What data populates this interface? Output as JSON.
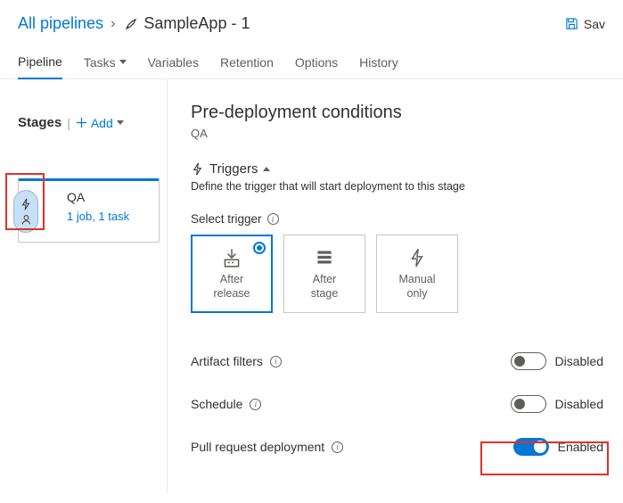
{
  "breadcrumb": {
    "root": "All pipelines",
    "title": "SampleApp - 1"
  },
  "save_label": "Sav",
  "tabs": [
    "Pipeline",
    "Tasks",
    "Variables",
    "Retention",
    "Options",
    "History"
  ],
  "stages": {
    "header": "Stages",
    "add": "Add",
    "card": {
      "name": "QA",
      "sub": "1 job, 1 task"
    }
  },
  "panel": {
    "title": "Pre-deployment conditions",
    "stage": "QA",
    "triggers_label": "Triggers",
    "triggers_desc": "Define the trigger that will start deployment to this stage",
    "select_trigger": "Select trigger",
    "options": {
      "after_release": "After\nrelease",
      "after_stage": "After\nstage",
      "manual_only": "Manual\nonly"
    },
    "artifact_filters": "Artifact filters",
    "schedule": "Schedule",
    "pull_request": "Pull request deployment",
    "disabled": "Disabled",
    "enabled": "Enabled"
  }
}
